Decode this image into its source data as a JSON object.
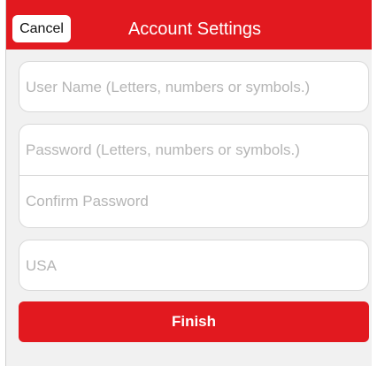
{
  "header": {
    "title": "Account Settings",
    "cancel_label": "Cancel"
  },
  "form": {
    "username": {
      "value": "",
      "placeholder": "User Name (Letters, numbers or symbols.)"
    },
    "password": {
      "value": "",
      "placeholder": "Password (Letters, numbers or symbols.)"
    },
    "confirm_password": {
      "value": "",
      "placeholder": "Confirm Password"
    },
    "country": {
      "value": "",
      "placeholder": "USA"
    }
  },
  "actions": {
    "finish_label": "Finish"
  },
  "colors": {
    "accent": "#e2191f",
    "background": "#f1f1f1",
    "card": "#ffffff",
    "placeholder": "#b5b5b5"
  }
}
